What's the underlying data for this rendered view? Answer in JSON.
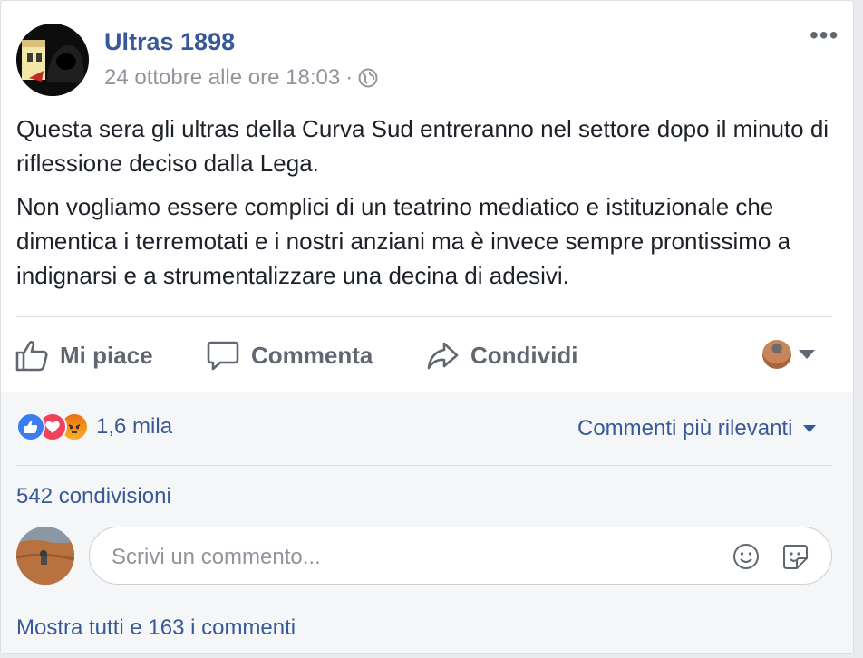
{
  "post": {
    "page_name": "Ultras 1898",
    "timestamp": "24 ottobre alle ore 18:03",
    "separator": "·",
    "audience_icon": "globe-icon",
    "more_icon": "•••",
    "paragraphs": [
      "Questa sera gli ultras della Curva Sud entreranno nel settore dopo il minuto di riflessione deciso dalla Lega.",
      "Non vogliamo essere complici di un teatrino mediatico e istituzionale che dimentica i terremotati e i nostri anziani ma è invece sempre prontissimo a indignarsi e a strumentalizzare una decina di adesivi."
    ]
  },
  "actions": {
    "like": "Mi piace",
    "comment": "Commenta",
    "share": "Condividi"
  },
  "stats": {
    "reactions": [
      "like",
      "love",
      "angry"
    ],
    "reaction_count": "1,6 mila",
    "sort_label": "Commenti più rilevanti",
    "shares": "542 condivisioni"
  },
  "comment": {
    "placeholder": "Scrivi un commento...",
    "show_all": "Mostra tutti e 163 i commenti"
  },
  "colors": {
    "link": "#385898",
    "muted": "#90949c",
    "action": "#606770",
    "like": "#3b7cf0",
    "love": "#f0415d",
    "angry": "#f0a02a"
  }
}
